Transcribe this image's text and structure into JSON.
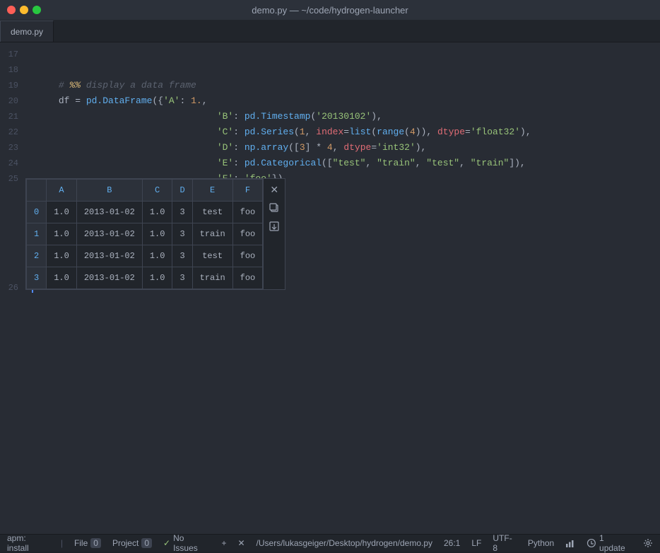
{
  "titleBar": {
    "title": "demo.py — ~/code/hydrogen-launcher"
  },
  "tabs": [
    {
      "label": "demo.py",
      "active": true
    }
  ],
  "code": {
    "lines": [
      {
        "num": "17",
        "content": ""
      },
      {
        "num": "18",
        "content": "comment_line"
      },
      {
        "num": "19",
        "content": "df_open"
      },
      {
        "num": "20",
        "content": "b_line"
      },
      {
        "num": "21",
        "content": "c_line"
      },
      {
        "num": "22",
        "content": "d_line"
      },
      {
        "num": "23",
        "content": "e_line"
      },
      {
        "num": "24",
        "content": "f_line"
      },
      {
        "num": "25",
        "content": "df_line"
      },
      {
        "num": "26",
        "content": ""
      }
    ]
  },
  "dataframe": {
    "columns": [
      "",
      "A",
      "B",
      "C",
      "D",
      "E",
      "F"
    ],
    "rows": [
      {
        "idx": "0",
        "A": "1.0",
        "B": "2013-01-02",
        "C": "1.0",
        "D": "3",
        "E": "test",
        "F": "foo"
      },
      {
        "idx": "1",
        "A": "1.0",
        "B": "2013-01-02",
        "C": "1.0",
        "D": "3",
        "E": "train",
        "F": "foo"
      },
      {
        "idx": "2",
        "A": "1.0",
        "B": "2013-01-02",
        "C": "1.0",
        "D": "3",
        "E": "test",
        "F": "foo"
      },
      {
        "idx": "3",
        "A": "1.0",
        "B": "2013-01-02",
        "C": "1.0",
        "D": "3",
        "E": "train",
        "F": "foo"
      }
    ]
  },
  "statusBar": {
    "apm": "apm: install",
    "file": "File",
    "fileCount": "0",
    "project": "Project",
    "projectCount": "0",
    "noIssues": "No Issues",
    "path": "/Users/lukasgeiger/Desktop/hydrogen/demo.py",
    "position": "26:1",
    "encoding": "LF",
    "charset": "UTF-8",
    "language": "Python",
    "gitUpdate": "1 update"
  }
}
